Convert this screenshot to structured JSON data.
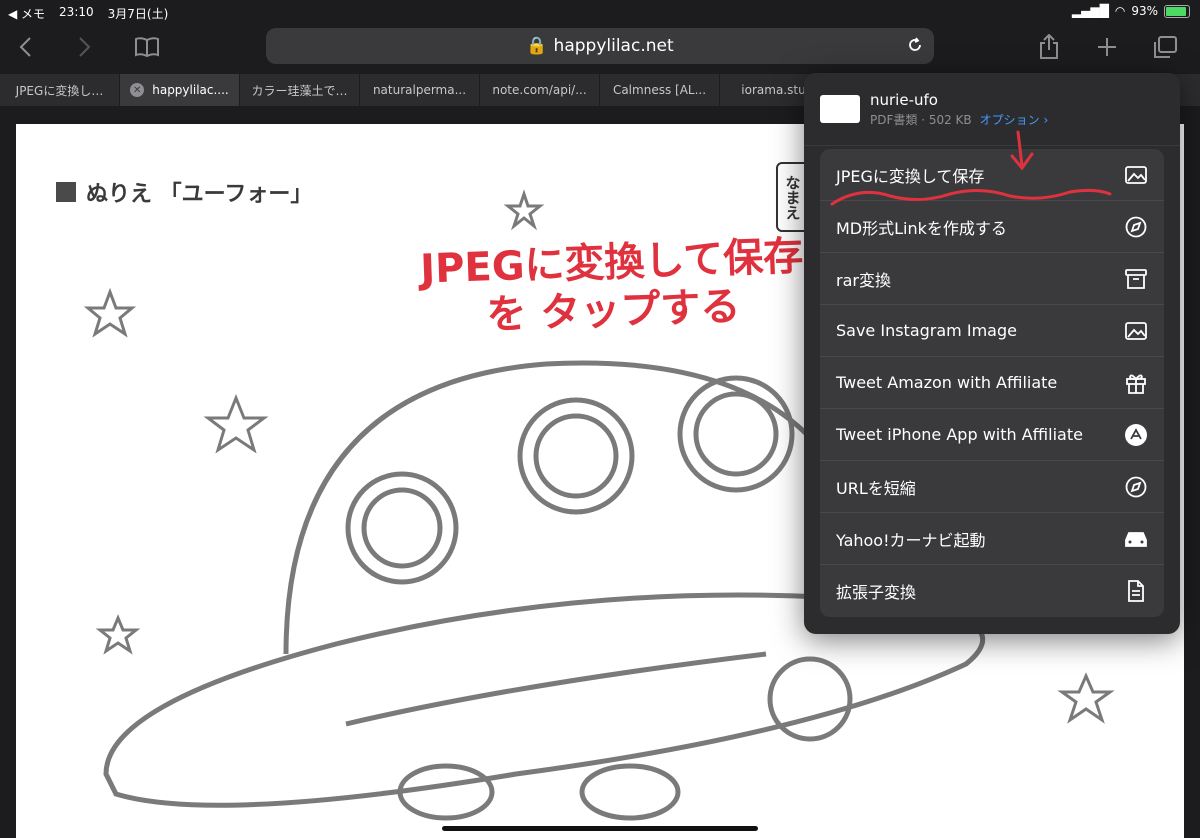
{
  "status_bar": {
    "back_app": "◀ メモ",
    "time": "23:10",
    "date": "3月7日(土)",
    "battery": "93%"
  },
  "toolbar": {
    "url": "happylilac.net"
  },
  "tabs": [
    {
      "label": "JPEGに変換し…",
      "active": false
    },
    {
      "label": "happylilac....",
      "active": true
    },
    {
      "label": "カラー珪藻土で…",
      "active": false
    },
    {
      "label": "naturalperma...",
      "active": false
    },
    {
      "label": "note.com/api/...",
      "active": false
    },
    {
      "label": "Calmness [AL...",
      "active": false
    },
    {
      "label": "iorama.stu…",
      "active": false
    }
  ],
  "page": {
    "title": "ぬりえ 「ユーフォー」",
    "name_label": "なまえ",
    "annotation_line1": "JPEGに変換して保存",
    "annotation_line2": "を タップする"
  },
  "share_sheet": {
    "doc_title": "nurie-ufo",
    "doc_meta": "PDF書類 · 502 KB",
    "options_label": "オプション ›",
    "actions": [
      {
        "label": "JPEGに変換して保存",
        "icon": "photo-icon"
      },
      {
        "label": "MD形式Linkを作成する",
        "icon": "compass-icon"
      },
      {
        "label": "rar変換",
        "icon": "archive-icon"
      },
      {
        "label": "Save Instagram Image",
        "icon": "photo-icon"
      },
      {
        "label": "Tweet Amazon with Affiliate",
        "icon": "gift-icon"
      },
      {
        "label": "Tweet iPhone App with Affiliate",
        "icon": "app-store-icon"
      },
      {
        "label": "URLを短縮",
        "icon": "compass-icon"
      },
      {
        "label": "Yahoo!カーナビ起動",
        "icon": "car-icon"
      },
      {
        "label": "拡張子変換",
        "icon": "document-icon"
      }
    ]
  }
}
